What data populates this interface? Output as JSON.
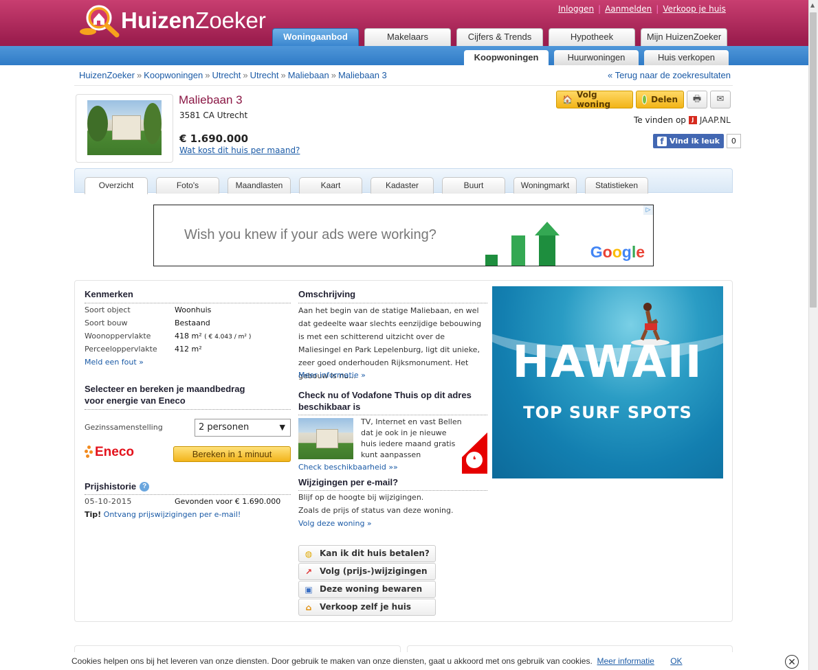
{
  "header": {
    "logo_bold": "Huizen",
    "logo_light": "Zoeker",
    "toplinks": [
      "Inloggen",
      "Aanmelden",
      "Verkoop je huis"
    ],
    "main_tabs": [
      "Woningaanbod",
      "Makelaars",
      "Cijfers & Trends",
      "Hypotheek",
      "Mijn HuizenZoeker"
    ],
    "sub_tabs": [
      "Koopwoningen",
      "Huurwoningen",
      "Huis verkopen"
    ]
  },
  "breadcrumb": [
    "HuizenZoeker",
    "Koopwoningen",
    "Utrecht",
    "Utrecht",
    "Maliebaan",
    "Maliebaan 3"
  ],
  "back_link": "« Terug naar de zoekresultaten",
  "listing": {
    "title": "Maliebaan 3",
    "address": "3581 CA Utrecht",
    "price": "€ 1.690.000",
    "monthly_link": "Wat kost dit huis per maand?",
    "follow_button": "Volg woning",
    "share_button": "Delen",
    "found_on_label": "Te vinden op",
    "found_on_site": "JAAP.NL",
    "fb_like": "Vind ik leuk",
    "fb_count": "0"
  },
  "detail_tabs": [
    "Overzicht",
    "Foto's",
    "Maandlasten",
    "Kaart",
    "Kadaster",
    "Buurt",
    "Woningmarkt",
    "Statistieken"
  ],
  "ad_banner": {
    "text": "Wish you knew if your ads were working?",
    "brand": "Google"
  },
  "kenmerken": {
    "heading": "Kenmerken",
    "rows": [
      {
        "label": "Soort object",
        "value": "Woonhuis"
      },
      {
        "label": "Soort bouw",
        "value": "Bestaand"
      },
      {
        "label": "Woonoppervlakte",
        "value": "418 m²",
        "extra": "( € 4.043 / m² )"
      },
      {
        "label": "Perceeloppervlakte",
        "value": "412 m²"
      }
    ],
    "report_link": "Meld een fout »"
  },
  "energy": {
    "heading_line1": "Selecteer en bereken je maandbedrag",
    "heading_line2": "voor energie van Eneco",
    "household_label": "Gezinssamenstelling",
    "household_value": "2 personen",
    "eneco": "Eneco",
    "calc_button": "Bereken in 1 minuut"
  },
  "price_history": {
    "heading": "Prijshistorie",
    "date": "05-10-2015",
    "event": "Gevonden voor € 1.690.000",
    "tip_label": "Tip!",
    "tip_link": "Ontvang prijswijzigingen per e-mail!"
  },
  "description": {
    "heading": "Omschrijving",
    "text": "Aan het begin van de statige Maliebaan, en wel dat gedeelte waar slechts eenzijdige bebouwing is met een schitterend uitzicht over de Maliesingel en Park Lepelenburg, ligt dit unieke, zeer goed onderhouden Rijksmonument. Het gebouw is nu...",
    "more_link": "Meer informatie »"
  },
  "vodafone": {
    "heading_line1": "Check nu of Vodafone Thuis op dit adres",
    "heading_line2": "beschikbaar is",
    "text": "TV, Internet en vast Bellen dat je ook in je nieuwe huis iedere maand gratis kunt aanpassen",
    "link": "Check beschikbaarheid »»"
  },
  "email_alerts": {
    "heading": "Wijzigingen per e-mail?",
    "line1": "Blijf op de hoogte bij wijzigingen.",
    "line2": "Zoals de prijs of status van deze woning.",
    "link": "Volg deze woning »"
  },
  "action_buttons": [
    "Kan ik dit huis betalen?",
    "Volg (prijs-)wijzigingen",
    "Deze woning bewaren",
    "Verkoop zelf je huis"
  ],
  "hawaii_ad": {
    "title": "HAWAII",
    "subtitle": "TOP SURF SPOTS"
  },
  "cookie_bar": {
    "text": "Cookies helpen ons bij het leveren van onze diensten. Door gebruik te maken van onze diensten, gaat u akkoord met ons gebruik van cookies.",
    "more": "Meer informatie",
    "ok": "OK"
  },
  "colors": {
    "brand": "#9e1f50",
    "nav_blue": "#3a86cf",
    "link": "#1a5aa6",
    "button_yellow": "#f2b417"
  }
}
